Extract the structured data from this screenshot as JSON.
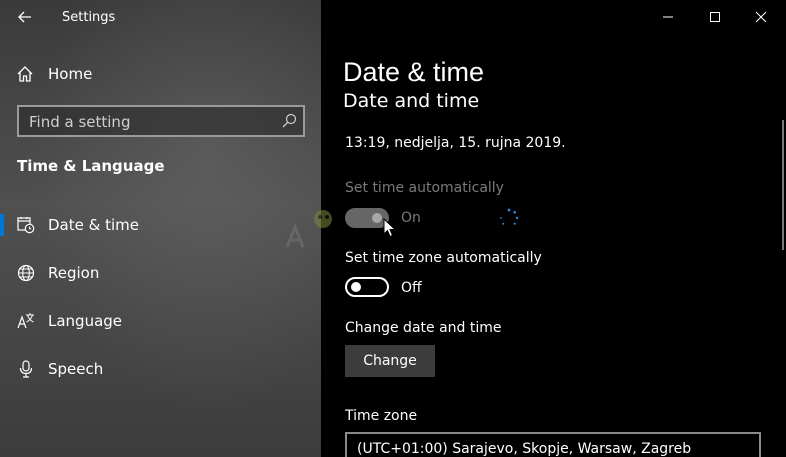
{
  "window": {
    "title": "Settings"
  },
  "sidebar": {
    "home_label": "Home",
    "search_placeholder": "Find a setting",
    "section_title": "Time & Language",
    "items": [
      {
        "label": "Date & time",
        "icon": "calendar-clock-icon",
        "active": true
      },
      {
        "label": "Region",
        "icon": "globe-icon",
        "active": false
      },
      {
        "label": "Language",
        "icon": "language-icon",
        "active": false
      },
      {
        "label": "Speech",
        "icon": "microphone-icon",
        "active": false
      }
    ]
  },
  "main": {
    "page_title": "Date & time",
    "section_heading": "Date and time",
    "current_datetime": "13:19, nedjelja, 15. rujna 2019.",
    "set_time_auto": {
      "label": "Set time automatically",
      "state": "On",
      "enabled": false
    },
    "set_timezone_auto": {
      "label": "Set time zone automatically",
      "state": "Off",
      "enabled": true
    },
    "change_section_label": "Change date and time",
    "change_button": "Change",
    "timezone_label": "Time zone",
    "timezone_value": "(UTC+01:00) Sarajevo, Skopje, Warsaw, Zagreb"
  },
  "colors": {
    "accent": "#0078d7",
    "background": "#000000",
    "sidebar": "#454545"
  }
}
